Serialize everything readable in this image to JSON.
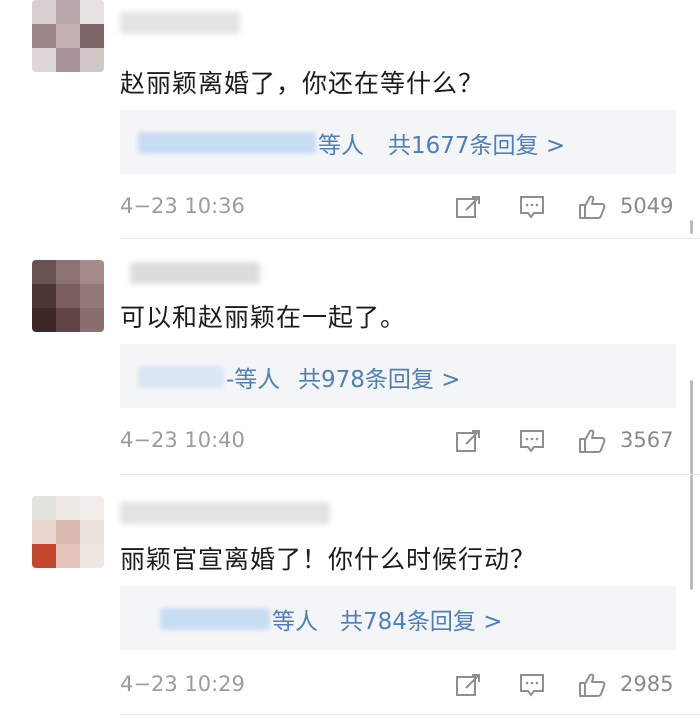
{
  "comments": [
    {
      "text": "赵丽颖离婚了，你还在等什么？",
      "replies": {
        "suffix": "等人",
        "count_label": "共1677条回复 >"
      },
      "time": "4−23 10:36",
      "likes": "5049"
    },
    {
      "text": "可以和赵丽颖在一起了。",
      "replies": {
        "suffix": "-等人",
        "count_label": "共978条回复 >"
      },
      "time": "4−23 10:40",
      "likes": "3567"
    },
    {
      "text": "丽颖官宣离婚了！你什么时候行动？",
      "replies": {
        "suffix": "等人",
        "count_label": "共784条回复 >"
      },
      "time": "4−23 10:29",
      "likes": "2985"
    }
  ],
  "icons": {
    "share": "share-icon",
    "comment": "comment-icon",
    "like": "like-thumb-icon"
  },
  "colors": {
    "reply_link": "#4f7fba",
    "reply_bg": "#f4f5f7",
    "meta": "#9c9c9c"
  }
}
